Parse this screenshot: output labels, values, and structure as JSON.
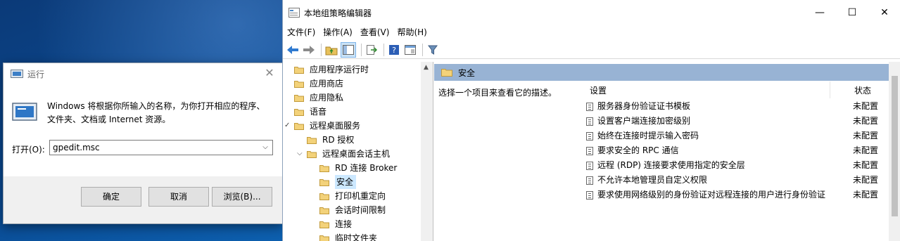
{
  "run_dialog": {
    "title": "运行",
    "description": "Windows 将根据你所输入的名称，为你打开相应的程序、文件夹、文档或 Internet 资源。",
    "open_label": "打开(O):",
    "open_value": "gpedit.msc",
    "buttons": {
      "ok": "确定",
      "cancel": "取消",
      "browse": "浏览(B)..."
    }
  },
  "gp_editor": {
    "title": "本地组策略编辑器",
    "menu": [
      "文件(F)",
      "操作(A)",
      "查看(V)",
      "帮助(H)"
    ],
    "tree": [
      "应用程序运行时",
      "应用商店",
      "应用隐私",
      "语音",
      "远程桌面服务",
      "RD 授权",
      "远程桌面会话主机",
      "RD 连接 Broker",
      "安全",
      "打印机重定向",
      "会话时间限制",
      "连接",
      "临时文件夹"
    ],
    "selected_heading": "安全",
    "description_hint": "选择一个项目来查看它的描述。",
    "columns": {
      "setting": "设置",
      "status": "状态"
    },
    "settings": [
      {
        "name": "服务器身份验证证书模板",
        "status": "未配置"
      },
      {
        "name": "设置客户端连接加密级别",
        "status": "未配置"
      },
      {
        "name": "始终在连接时提示输入密码",
        "status": "未配置"
      },
      {
        "name": "要求安全的 RPC 通信",
        "status": "未配置"
      },
      {
        "name": "远程 (RDP) 连接要求使用指定的安全层",
        "status": "未配置"
      },
      {
        "name": "不允许本地管理员自定义权限",
        "status": "未配置"
      },
      {
        "name": "要求使用网络级别的身份验证对远程连接的用户进行身份验证",
        "status": "未配置"
      }
    ]
  },
  "colors": {
    "heading_bar": "#98b3d4",
    "selection": "#cce8ff",
    "folder": "#e8c15a"
  }
}
